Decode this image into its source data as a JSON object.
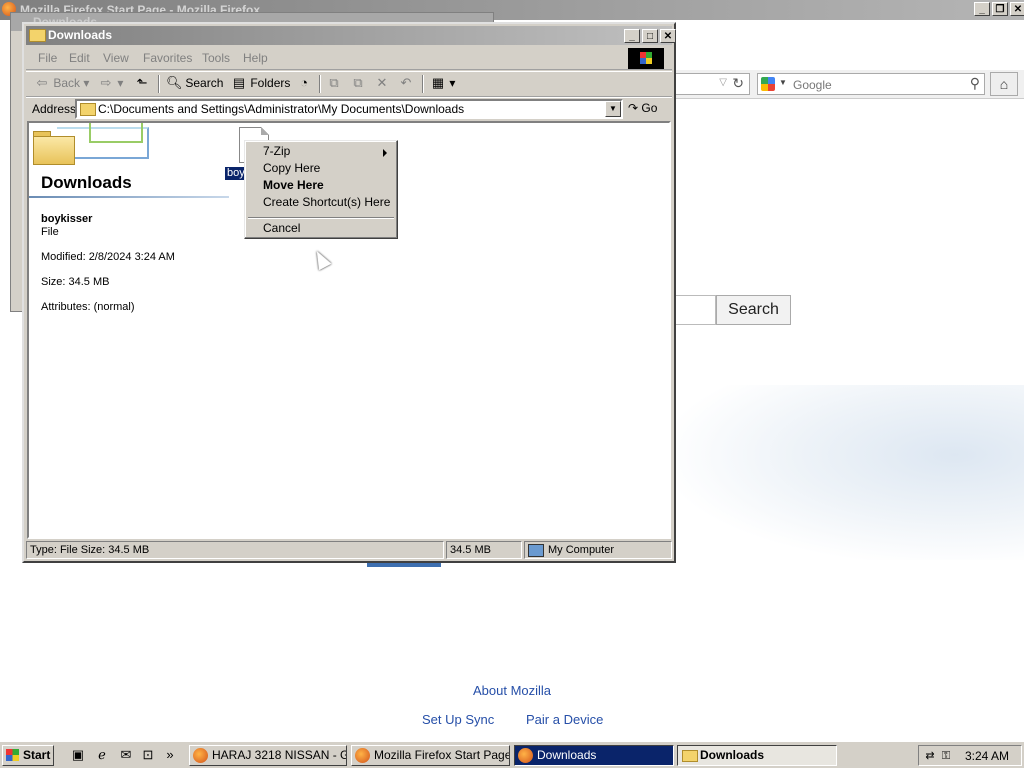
{
  "firefox": {
    "window_title": "Mozilla Firefox Start Page - Mozilla Firefox",
    "ghost_window_title": "Downloads",
    "search_placeholder": "Google",
    "search_button": "Search",
    "footer_links": [
      "About Mozilla",
      "Set Up Sync",
      "Pair a Device"
    ]
  },
  "explorer": {
    "title": "Downloads",
    "menu": [
      "File",
      "Edit",
      "View",
      "Favorites",
      "Tools",
      "Help"
    ],
    "toolbar": {
      "back": "Back",
      "search": "Search",
      "folders": "Folders"
    },
    "address": {
      "label": "Address",
      "path": "C:\\Documents and Settings\\Administrator\\My Documents\\Downloads",
      "go": "Go"
    },
    "pane": {
      "title": "Downloads",
      "file_name": "boykisser",
      "file_type": "File",
      "modified": "Modified: 2/8/2024 3:24 AM",
      "size": "Size: 34.5 MB",
      "attributes": "Attributes: (normal)"
    },
    "selected_file_label": "boy",
    "status": {
      "left": "Type: File Size: 34.5 MB",
      "size": "34.5 MB",
      "zone": "My Computer"
    }
  },
  "context_menu": {
    "items": [
      "7-Zip",
      "Copy Here",
      "Move Here",
      "Create Shortcut(s) Here",
      "Cancel"
    ]
  },
  "taskbar": {
    "start": "Start",
    "tasks": [
      "HARAJ 3218 NISSAN - G...",
      "Mozilla Firefox Start Page -...",
      "Downloads",
      "Downloads"
    ],
    "clock": "3:24 AM"
  }
}
